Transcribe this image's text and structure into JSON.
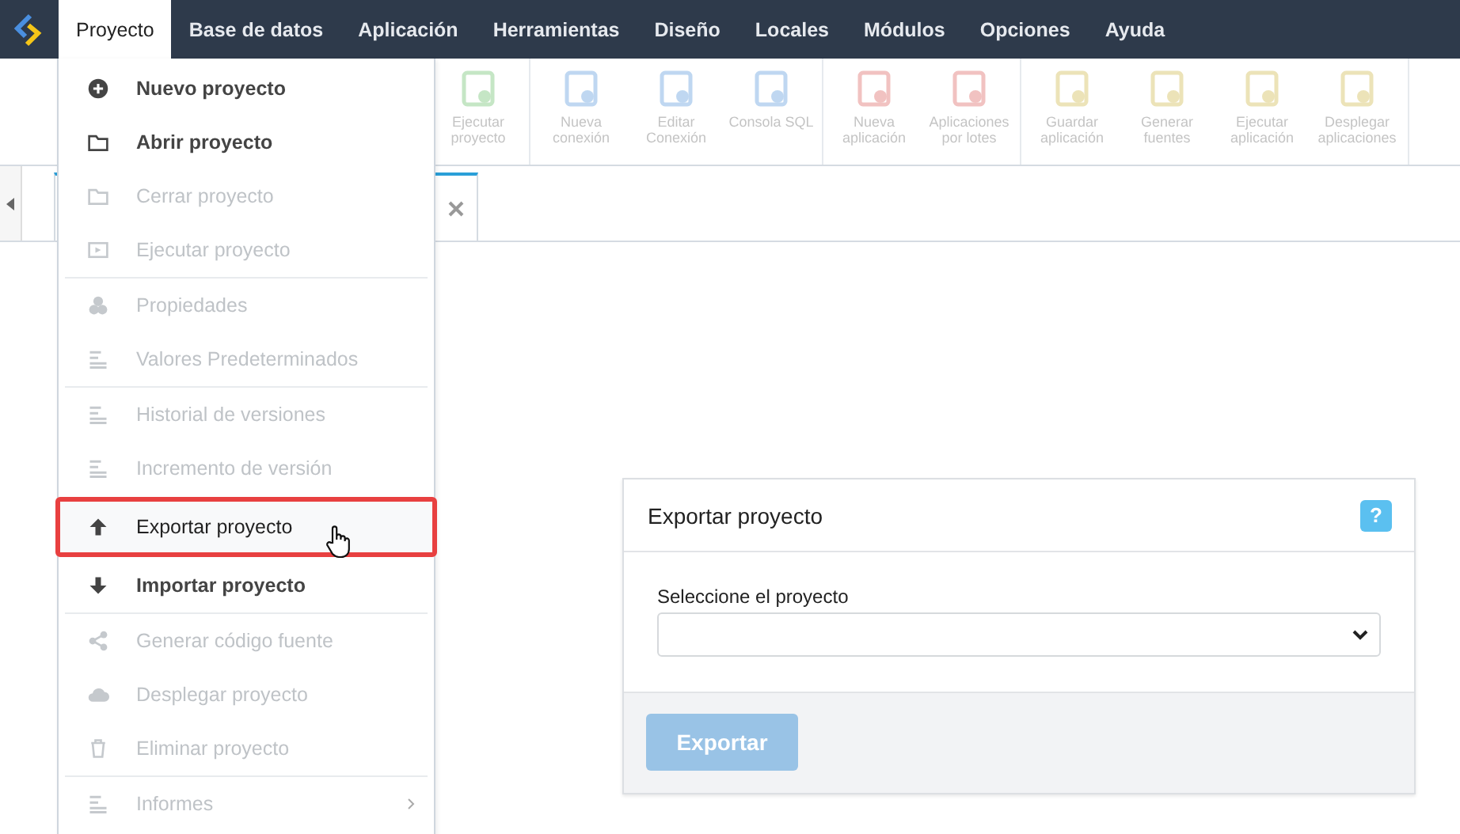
{
  "menubar": {
    "items": [
      {
        "label": "Proyecto",
        "selected": true
      },
      {
        "label": "Base de datos",
        "selected": false
      },
      {
        "label": "Aplicación",
        "selected": false
      },
      {
        "label": "Herramientas",
        "selected": false
      },
      {
        "label": "Diseño",
        "selected": false
      },
      {
        "label": "Locales",
        "selected": false
      },
      {
        "label": "Módulos",
        "selected": false
      },
      {
        "label": "Opciones",
        "selected": false
      },
      {
        "label": "Ayuda",
        "selected": false
      }
    ]
  },
  "toolbar": {
    "groups": [
      [
        {
          "label": "Ejecutar proyecto",
          "disabled": true
        }
      ],
      [
        {
          "label": "Nueva conexión",
          "disabled": true
        },
        {
          "label": "Editar Conexión",
          "disabled": true
        },
        {
          "label": "Consola SQL",
          "disabled": true
        }
      ],
      [
        {
          "label": "Nueva aplicación",
          "disabled": true
        },
        {
          "label": "Aplicaciones por lotes",
          "disabled": true
        }
      ],
      [
        {
          "label": "Guardar aplicación",
          "disabled": true
        },
        {
          "label": "Generar fuentes",
          "disabled": true
        },
        {
          "label": "Ejecutar aplicación",
          "disabled": true
        },
        {
          "label": "Desplegar aplicaciones",
          "disabled": true
        }
      ]
    ]
  },
  "project_menu": {
    "items": [
      {
        "kind": "item",
        "label": "Nuevo proyecto",
        "disabled": false,
        "selected": false
      },
      {
        "kind": "item",
        "label": "Abrir proyecto",
        "disabled": false,
        "selected": false
      },
      {
        "kind": "item",
        "label": "Cerrar proyecto",
        "disabled": true,
        "selected": false
      },
      {
        "kind": "item",
        "label": "Ejecutar proyecto",
        "disabled": true,
        "selected": false
      },
      {
        "kind": "separator"
      },
      {
        "kind": "item",
        "label": "Propiedades",
        "disabled": true,
        "selected": false
      },
      {
        "kind": "item",
        "label": "Valores Predeterminados",
        "disabled": true,
        "selected": false
      },
      {
        "kind": "separator"
      },
      {
        "kind": "item",
        "label": "Historial de versiones",
        "disabled": true,
        "selected": false
      },
      {
        "kind": "item",
        "label": "Incremento de versión",
        "disabled": true,
        "selected": false
      },
      {
        "kind": "item",
        "label": "Exportar proyecto",
        "disabled": false,
        "selected": true
      },
      {
        "kind": "item",
        "label": "Importar proyecto",
        "disabled": false,
        "selected": false
      },
      {
        "kind": "separator"
      },
      {
        "kind": "item",
        "label": "Generar código fuente",
        "disabled": true,
        "selected": false
      },
      {
        "kind": "item",
        "label": "Desplegar proyecto",
        "disabled": true,
        "selected": false
      },
      {
        "kind": "item",
        "label": "Eliminar proyecto",
        "disabled": true,
        "selected": false
      },
      {
        "kind": "separator"
      },
      {
        "kind": "item",
        "label": "Informes",
        "disabled": true,
        "selected": false,
        "submenu": true
      }
    ]
  },
  "export_panel": {
    "title": "Exportar proyecto",
    "help": "?",
    "field_label": "Seleccione el proyecto",
    "button": {
      "label": "Exportar",
      "disabled": true
    }
  }
}
